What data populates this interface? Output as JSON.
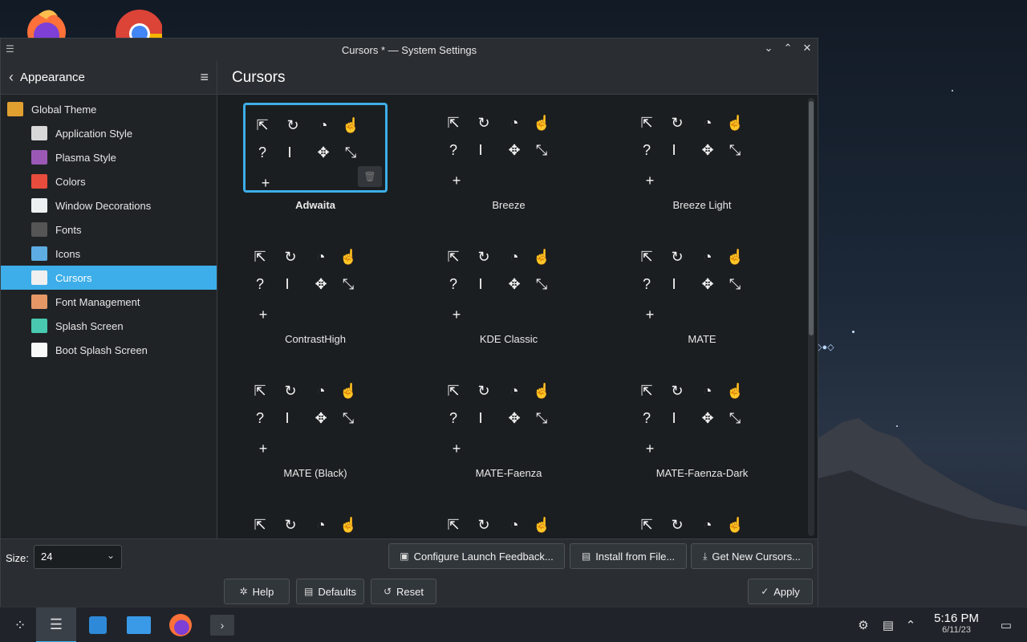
{
  "window": {
    "title": "Cursors * — System Settings",
    "minimize": "⌄",
    "maximize": "⌃",
    "close": "✕"
  },
  "sidebar": {
    "back_label": "Appearance",
    "items": [
      {
        "label": "Global Theme",
        "icon": "global-theme-icon",
        "color": "#e0a030"
      },
      {
        "label": "Application Style",
        "icon": "application-style-icon",
        "color": "#d8d8d8"
      },
      {
        "label": "Plasma Style",
        "icon": "plasma-style-icon",
        "color": "#9b59b6"
      },
      {
        "label": "Colors",
        "icon": "colors-icon",
        "color": "#e74c3c"
      },
      {
        "label": "Window Decorations",
        "icon": "window-decorations-icon",
        "color": "#ecf0f1"
      },
      {
        "label": "Fonts",
        "icon": "fonts-icon",
        "color": "#555"
      },
      {
        "label": "Icons",
        "icon": "icons-icon",
        "color": "#5dade2"
      },
      {
        "label": "Cursors",
        "icon": "cursors-icon",
        "color": "#f0f0f0"
      },
      {
        "label": "Font Management",
        "icon": "font-management-icon",
        "color": "#e59866"
      },
      {
        "label": "Splash Screen",
        "icon": "splash-screen-icon",
        "color": "#48c9b0"
      },
      {
        "label": "Boot Splash Screen",
        "icon": "boot-splash-screen-icon",
        "color": "#f8f9f9"
      }
    ],
    "active": "Cursors"
  },
  "main": {
    "title": "Cursors",
    "themes": [
      {
        "name": "Adwaita",
        "selected": true
      },
      {
        "name": "Breeze",
        "selected": false
      },
      {
        "name": "Breeze Light",
        "selected": false
      },
      {
        "name": "ContrastHigh",
        "selected": false
      },
      {
        "name": "KDE Classic",
        "selected": false
      },
      {
        "name": "MATE",
        "selected": false
      },
      {
        "name": "MATE (Black)",
        "selected": false
      },
      {
        "name": "MATE-Faenza",
        "selected": false
      },
      {
        "name": "MATE-Faenza-Dark",
        "selected": false
      },
      {
        "name": "",
        "selected": false
      },
      {
        "name": "",
        "selected": false
      },
      {
        "name": "",
        "selected": false
      }
    ]
  },
  "footer": {
    "size_label": "Size:",
    "size_value": "24",
    "configure_label": "Configure Launch Feedback...",
    "install_label": "Install from File...",
    "get_new_label": "Get New Cursors...",
    "help_label": "Help",
    "defaults_label": "Defaults",
    "reset_label": "Reset",
    "apply_label": "Apply"
  },
  "taskbar": {
    "time": "5:16 PM",
    "date": "6/11/23"
  },
  "colors": {
    "accent": "#3daee9",
    "window_bg": "#202326",
    "panel_bg": "#2a2e32"
  }
}
